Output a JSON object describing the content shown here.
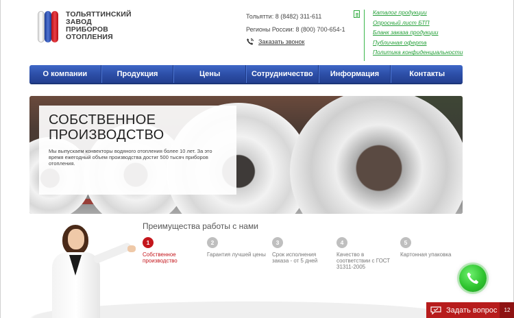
{
  "logo": {
    "lines": [
      "ТОЛЬЯТТИНСКИЙ",
      "ЗАВОД",
      "ПРИБОРОВ",
      "ОТОПЛЕНИЯ"
    ]
  },
  "contacts": {
    "tolyatti": "Тольятти: 8 (8482) 311-611",
    "regions": "Регионы России: 8 (800) 700-654-1",
    "callback": "Заказать звонок"
  },
  "links": [
    "Каталог продукции",
    "Опросный лист БТП",
    "Бланк заказа продукции",
    "Публичная оферта",
    "Политика конфиденциальности"
  ],
  "nav": [
    "О компании",
    "Продукция",
    "Цены",
    "Сотрудничество",
    "Информация",
    "Контакты"
  ],
  "banner": {
    "title_line1": "СОБСТВЕННОЕ",
    "title_line2": "ПРОИЗВОДСТВО",
    "desc": "Мы выпускаем конвекторы водяного отопления более 10 лет. За это время ежегодный объем производства достиг 500 тысяч приборов отопления."
  },
  "advantages": {
    "title": "Преимущества работы с нами",
    "steps": [
      {
        "num": "1",
        "text": "Собственное производство"
      },
      {
        "num": "2",
        "text": "Гарантия лучшей цены"
      },
      {
        "num": "3",
        "text": "Срок исполнения заказа - от 5 дней"
      },
      {
        "num": "4",
        "text": "Качество в соответствии с ГОСТ 31311-2005"
      },
      {
        "num": "5",
        "text": "Картонная упаковка"
      }
    ]
  },
  "ask_widget": {
    "label": "Задать вопрос",
    "count": "12"
  },
  "colors": {
    "nav_blue": "#2d4fa8",
    "accent_red": "#c4161c",
    "link_green": "#26a03a",
    "call_green": "#2fc42f"
  }
}
